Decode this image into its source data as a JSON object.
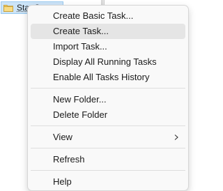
{
  "tree": {
    "selected_item_label": "StartSmoot",
    "folder_icon": "folder-icon"
  },
  "menu": {
    "items": [
      {
        "label": "Create Basic Task..."
      },
      {
        "label": "Create Task..."
      },
      {
        "label": "Import Task..."
      },
      {
        "label": "Display All Running Tasks"
      },
      {
        "label": "Enable All Tasks History"
      },
      {
        "label": "New Folder..."
      },
      {
        "label": "Delete Folder"
      },
      {
        "label": "View",
        "submenu_icon": "chevron-right-icon"
      },
      {
        "label": "Refresh"
      },
      {
        "label": "Help"
      }
    ],
    "highlighted_item": "Create Task..."
  }
}
